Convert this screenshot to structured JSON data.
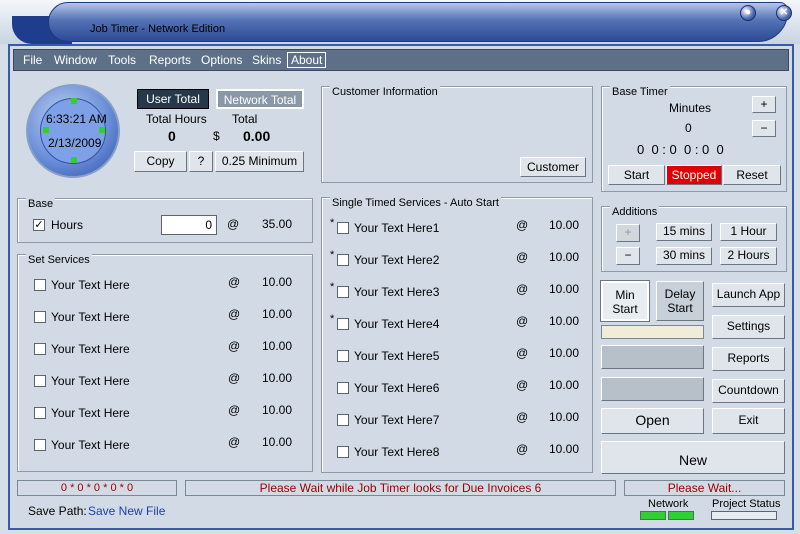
{
  "window": {
    "title": "Job Timer - Network Edition",
    "min": "●",
    "close": "✕"
  },
  "menu": [
    "File",
    "Window",
    "Tools",
    "Reports",
    "Options",
    "Skins",
    "About"
  ],
  "clock": {
    "time": "6:33:21 AM",
    "date": "2/13/2009"
  },
  "totals": {
    "user_total": "User Total",
    "network_total": "Network Total",
    "hours_label": "Total Hours",
    "total_label": "Total",
    "hours_value": "0",
    "currency": "$",
    "total_value": "0.00",
    "copy": "Copy",
    "help": "?",
    "minimum": "0.25 Minimum"
  },
  "customer": {
    "title": "Customer Information",
    "button": "Customer"
  },
  "base_timer": {
    "title": "Base Timer",
    "minutes_label": "Minutes",
    "plus": "+",
    "minus": "−",
    "minutes_value": "0",
    "display": "0  0 : 0  0 : 0  0",
    "start": "Start",
    "stopped": "Stopped",
    "reset": "Reset"
  },
  "additions": {
    "title": "Additions",
    "plus": "+",
    "minus": "−",
    "b15": "15 mins",
    "b1h": "1 Hour",
    "b30": "30 mins",
    "b2h": "2 Hours"
  },
  "base": {
    "title": "Base",
    "label": "Hours",
    "value": "0",
    "at": "@",
    "rate": "35.00"
  },
  "set_services": {
    "title": "Set Services",
    "items": [
      {
        "label": "Your Text Here",
        "at": "@",
        "rate": "10.00"
      },
      {
        "label": "Your Text Here",
        "at": "@",
        "rate": "10.00"
      },
      {
        "label": "Your Text Here",
        "at": "@",
        "rate": "10.00"
      },
      {
        "label": "Your Text Here",
        "at": "@",
        "rate": "10.00"
      },
      {
        "label": "Your Text Here",
        "at": "@",
        "rate": "10.00"
      },
      {
        "label": "Your Text Here",
        "at": "@",
        "rate": "10.00"
      }
    ]
  },
  "single_services": {
    "title": "Single Timed Services - Auto Start",
    "items": [
      {
        "star": "*",
        "label": "Your Text Here1",
        "at": "@",
        "rate": "10.00"
      },
      {
        "star": "*",
        "label": "Your Text Here2",
        "at": "@",
        "rate": "10.00"
      },
      {
        "star": "*",
        "label": "Your Text Here3",
        "at": "@",
        "rate": "10.00"
      },
      {
        "star": "*",
        "label": "Your Text Here4",
        "at": "@",
        "rate": "10.00"
      },
      {
        "star": "",
        "label": "Your Text Here5",
        "at": "@",
        "rate": "10.00"
      },
      {
        "star": "",
        "label": "Your Text Here6",
        "at": "@",
        "rate": "10.00"
      },
      {
        "star": "",
        "label": "Your Text Here7",
        "at": "@",
        "rate": "10.00"
      },
      {
        "star": "",
        "label": "Your Text Here8",
        "at": "@",
        "rate": "10.00"
      }
    ]
  },
  "side": {
    "min_start": "Min Start",
    "delay_start": "Delay Start",
    "launch_app": "Launch App",
    "settings": "Settings",
    "reports": "Reports",
    "countdown": "Countdown",
    "open": "Open",
    "exit": "Exit",
    "new": "New"
  },
  "status": {
    "counts": "0 * 0 * 0 * 0 * 0",
    "message": "Please Wait while Job Timer looks for Due Invoices 6",
    "wait": "Please Wait...",
    "save_label": "Save Path:",
    "save_link": "Save New File",
    "network": "Network",
    "project_status": "Project Status"
  },
  "colors": {
    "accent": "#2c4a96",
    "stopped": "#e00000",
    "status_text": "#a00000",
    "link": "#1a3fb0"
  }
}
